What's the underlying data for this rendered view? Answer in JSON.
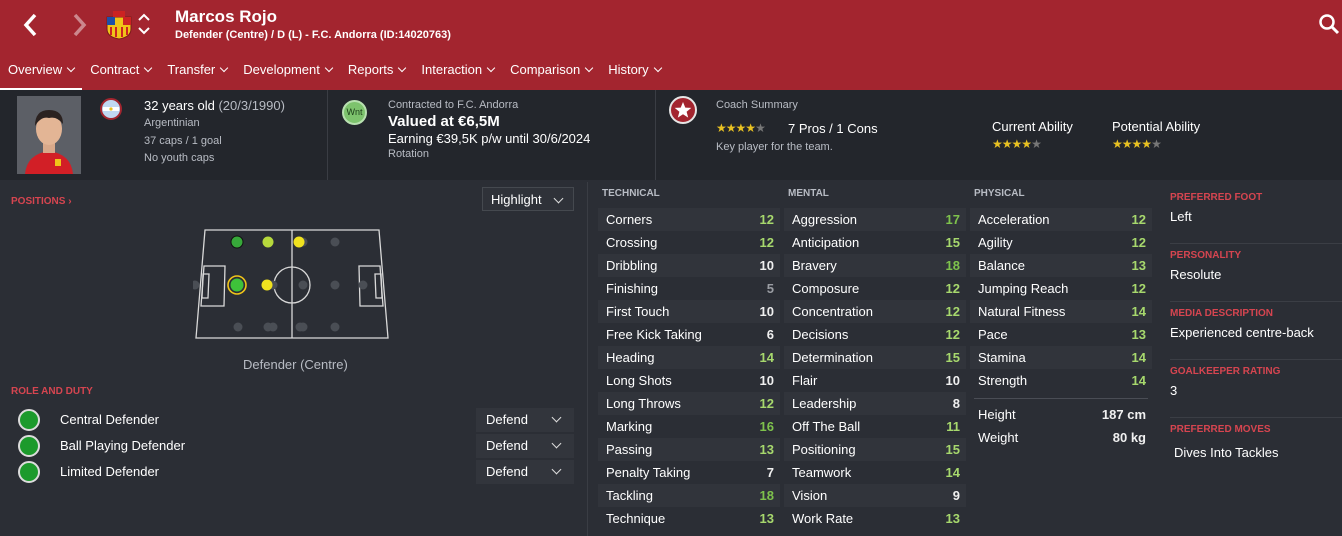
{
  "header": {
    "player_name": "Marcos Rojo",
    "subtitle": "Defender (Centre) / D (L) - F.C. Andorra (ID:14020763)",
    "icons": [
      "back-arrow-icon",
      "forward-arrow-icon",
      "club-crest-icon",
      "up-down-arrows-icon",
      "search-icon"
    ],
    "brand_color": "#a3252f"
  },
  "tabs": [
    {
      "label": "Overview"
    },
    {
      "label": "Contract"
    },
    {
      "label": "Transfer"
    },
    {
      "label": "Development"
    },
    {
      "label": "Reports"
    },
    {
      "label": "Interaction"
    },
    {
      "label": "Comparison"
    },
    {
      "label": "History"
    }
  ],
  "info": {
    "age": "32 years old",
    "dob": "(20/3/1990)",
    "nationality": "Argentinian",
    "caps": "37 caps / 1 goal",
    "youth": "No youth caps",
    "contract_label": "Contracted to F.C. Andorra",
    "value": "Valued at €6,5M",
    "earning": "Earning €39,5K p/w until 30/6/2024",
    "status": "Rotation",
    "wnt_badge": "Wnt",
    "coach_summary_label": "Coach Summary",
    "pros_cons": "7 Pros / 1 Cons",
    "coach_stars": 4,
    "coach_note": "Key player for the team.",
    "current_ability_label": "Current Ability",
    "current_ability_stars": 4,
    "potential_ability_label": "Potential Ability",
    "potential_ability_stars": 4
  },
  "positions": {
    "title": "POSITIONS",
    "highlight_label": "Highlight",
    "position_label": "Defender (Centre)"
  },
  "roles": {
    "title": "ROLE AND DUTY",
    "items": [
      {
        "name": "Central Defender",
        "duty": "Defend"
      },
      {
        "name": "Ball Playing Defender",
        "duty": "Defend"
      },
      {
        "name": "Limited Defender",
        "duty": "Defend"
      }
    ]
  },
  "technical": {
    "title": "TECHNICAL",
    "attrs": [
      {
        "name": "Corners",
        "value": "12"
      },
      {
        "name": "Crossing",
        "value": "12"
      },
      {
        "name": "Dribbling",
        "value": "10"
      },
      {
        "name": "Finishing",
        "value": "5"
      },
      {
        "name": "First Touch",
        "value": "10"
      },
      {
        "name": "Free Kick Taking",
        "value": "6"
      },
      {
        "name": "Heading",
        "value": "14"
      },
      {
        "name": "Long Shots",
        "value": "10"
      },
      {
        "name": "Long Throws",
        "value": "12"
      },
      {
        "name": "Marking",
        "value": "16"
      },
      {
        "name": "Passing",
        "value": "13"
      },
      {
        "name": "Penalty Taking",
        "value": "7"
      },
      {
        "name": "Tackling",
        "value": "18"
      },
      {
        "name": "Technique",
        "value": "13"
      }
    ]
  },
  "mental": {
    "title": "MENTAL",
    "attrs": [
      {
        "name": "Aggression",
        "value": "17"
      },
      {
        "name": "Anticipation",
        "value": "15"
      },
      {
        "name": "Bravery",
        "value": "18"
      },
      {
        "name": "Composure",
        "value": "12"
      },
      {
        "name": "Concentration",
        "value": "12"
      },
      {
        "name": "Decisions",
        "value": "12"
      },
      {
        "name": "Determination",
        "value": "15"
      },
      {
        "name": "Flair",
        "value": "10"
      },
      {
        "name": "Leadership",
        "value": "8"
      },
      {
        "name": "Off The Ball",
        "value": "11"
      },
      {
        "name": "Positioning",
        "value": "15"
      },
      {
        "name": "Teamwork",
        "value": "14"
      },
      {
        "name": "Vision",
        "value": "9"
      },
      {
        "name": "Work Rate",
        "value": "13"
      }
    ]
  },
  "physical": {
    "title": "PHYSICAL",
    "attrs": [
      {
        "name": "Acceleration",
        "value": "12"
      },
      {
        "name": "Agility",
        "value": "12"
      },
      {
        "name": "Balance",
        "value": "13"
      },
      {
        "name": "Jumping Reach",
        "value": "12"
      },
      {
        "name": "Natural Fitness",
        "value": "14"
      },
      {
        "name": "Pace",
        "value": "13"
      },
      {
        "name": "Stamina",
        "value": "14"
      },
      {
        "name": "Strength",
        "value": "14"
      }
    ],
    "height_label": "Height",
    "height": "187 cm",
    "weight_label": "Weight",
    "weight": "80 kg"
  },
  "side": {
    "preferred_foot_label": "PREFERRED FOOT",
    "preferred_foot": "Left",
    "personality_label": "PERSONALITY",
    "personality": "Resolute",
    "media_label": "MEDIA DESCRIPTION",
    "media": "Experienced centre-back",
    "gk_label": "GOALKEEPER RATING",
    "gk": "3",
    "moves_label": "PREFERRED MOVES",
    "moves": "Dives Into Tackles"
  }
}
